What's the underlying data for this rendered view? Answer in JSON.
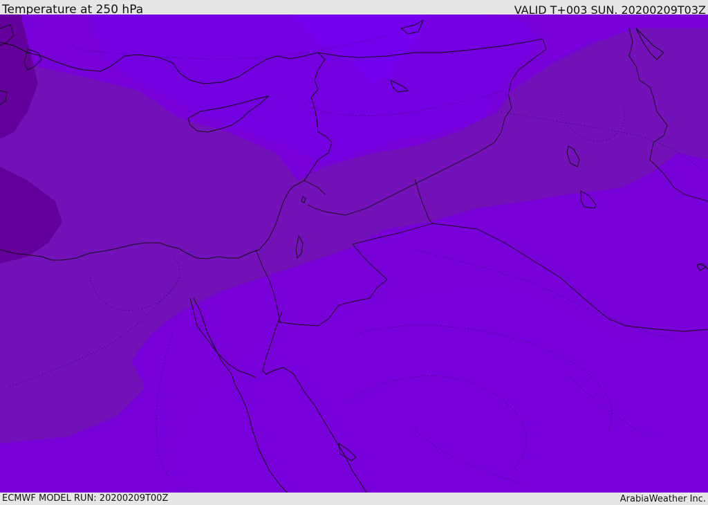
{
  "header": {
    "title": "Temperature at 250 hPa",
    "valid_time": "VALID T+003 SUN. 20200209T03Z"
  },
  "footer": {
    "model_run": "ECMWF MODEL RUN: 20200209T00Z",
    "credit": "ArabiaWeather Inc."
  },
  "map": {
    "colors": {
      "background_band": "#7b00d6",
      "warm_band": "#7400e2",
      "mid_band": "#7212b8",
      "cold_band": "#64009c",
      "warmest_band": "#7a00ff",
      "light_patch": "#6f10ff",
      "coastline": "#111111",
      "border": "#111111"
    },
    "legend_icons": [
      "coastline-path",
      "country-border-path",
      "contour-dotted-path"
    ]
  }
}
